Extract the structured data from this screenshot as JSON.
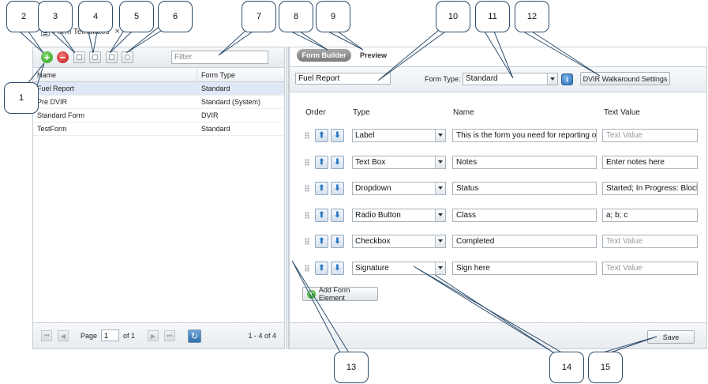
{
  "tab": {
    "title": "Form Templates",
    "close": "×"
  },
  "left_toolbar": {
    "filter_placeholder": "Filter",
    "add_glyph": "+",
    "remove_glyph": "−"
  },
  "grid": {
    "headers": {
      "name": "Name",
      "type": "Form Type"
    },
    "rows": [
      {
        "name": "Fuel Report",
        "type": "Standard",
        "selected": true
      },
      {
        "name": "Pre DVIR",
        "type": "Standard (System)"
      },
      {
        "name": "Standard Form",
        "type": "DVIR"
      },
      {
        "name": "TestForm",
        "type": "Standard"
      }
    ]
  },
  "pager": {
    "page_label": "Page",
    "page_value": "1",
    "of_label": "of 1",
    "count": "1 - 4 of 4",
    "refresh_glyph": "↻"
  },
  "builder": {
    "tab_builder": "Form Builder",
    "tab_preview": "Preview",
    "form_name": "Fuel Report",
    "form_type_label": "Form Type:",
    "form_type_value": "Standard",
    "info_glyph": "i",
    "dvir_button": "DVIR Walkaround Settings",
    "columns": {
      "order": "Order",
      "type": "Type",
      "name": "Name",
      "text_value": "Text Value"
    },
    "up_glyph": "⬆",
    "down_glyph": "⬇",
    "elements": [
      {
        "type": "Label",
        "name": "This is the form you need for reporting or",
        "text_value": "Text Value",
        "tv_placeholder": true
      },
      {
        "type": "Text Box",
        "name": "Notes",
        "text_value": "Enter notes here",
        "tv_placeholder": false
      },
      {
        "type": "Dropdown",
        "name": "Status",
        "text_value": "Started; In Progress: Block",
        "tv_placeholder": false
      },
      {
        "type": "Radio Button",
        "name": "Class",
        "text_value": "a; b; c",
        "tv_placeholder": false
      },
      {
        "type": "Checkbox",
        "name": "Completed",
        "text_value": "Text Value",
        "tv_placeholder": true
      },
      {
        "type": "Signature",
        "name": "Sign here",
        "text_value": "Text Value",
        "tv_placeholder": true
      }
    ],
    "add_element": "Add Form Element",
    "add_glyph": "+",
    "save": "Save"
  },
  "callouts": [
    "1",
    "2",
    "3",
    "4",
    "5",
    "6",
    "7",
    "8",
    "9",
    "10",
    "11",
    "12",
    "13",
    "14",
    "15"
  ]
}
